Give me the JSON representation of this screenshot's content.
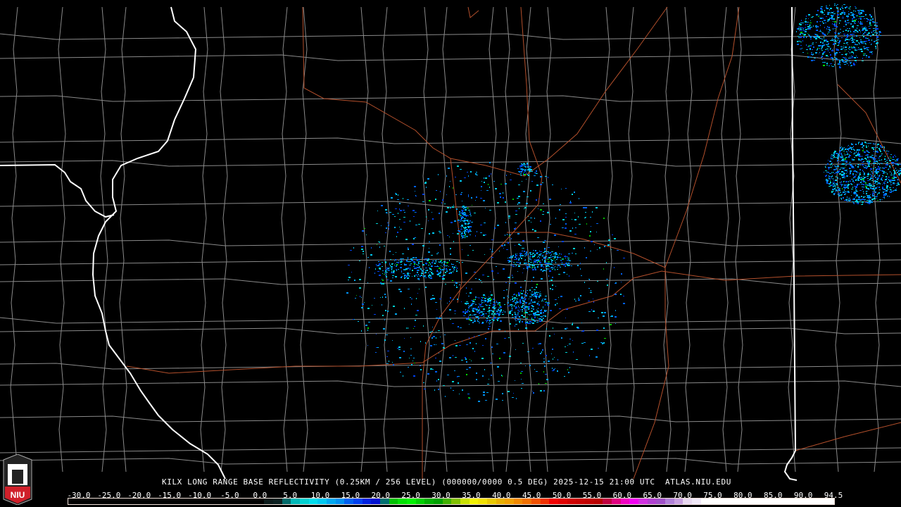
{
  "product": {
    "caption": "KILX LONG RANGE BASE REFLECTIVITY (0.25KM / 256 LEVEL) (000000/0000 0.5 DEG) 2025-12-15 21:00 UTC  ATLAS.NIU.EDU",
    "station": "KILX",
    "timestamp": "2025-12-15 21:00 UTC",
    "source": "ATLAS.NIU.EDU"
  },
  "logo": {
    "text": "NIU",
    "accent": "#d0202a"
  },
  "colorbar": {
    "ticks": [
      "-30.0",
      "-25.0",
      "-20.0",
      "-15.0",
      "-10.0",
      "-5.0",
      "0.0",
      "5.0",
      "10.0",
      "15.0",
      "20.0",
      "25.0",
      "30.0",
      "35.0",
      "40.0",
      "45.0",
      "50.0",
      "55.0",
      "60.0",
      "65.0",
      "70.0",
      "75.0",
      "80.0",
      "85.0",
      "90.0",
      "94.5"
    ],
    "colors": [
      "#000000",
      "#000000",
      "#000000",
      "#000000",
      "#000000",
      "#000000",
      "#000000",
      "#000000",
      "#000000",
      "#000000",
      "#000000",
      "#000000",
      "#000000",
      "#000000",
      "#000000",
      "#000000",
      "#000000",
      "#000000",
      "#000000",
      "#000000",
      "#000000",
      "#000000",
      "#0a1a1a",
      "#0a2020",
      "#006a6a",
      "#00b8b8",
      "#00d0d0",
      "#00dcec",
      "#00c8f0",
      "#00a8f0",
      "#0090f0",
      "#0060f0",
      "#0040f0",
      "#0020e0",
      "#0010d0",
      "#007070",
      "#00c000",
      "#00e000",
      "#00f000",
      "#00d000",
      "#00b000",
      "#00a000",
      "#40b000",
      "#80c000",
      "#c8e000",
      "#f0f000",
      "#f0e000",
      "#e8c800",
      "#e8b000",
      "#f0a000",
      "#f08800",
      "#f07000",
      "#f05000",
      "#f03000",
      "#f00000",
      "#e00000",
      "#d00000",
      "#c80000",
      "#c00000",
      "#b80000",
      "#c00040",
      "#e00080",
      "#f000c0",
      "#f000f0",
      "#d030e0",
      "#b040d0",
      "#a050c8",
      "#b080d8",
      "#c8a0e0",
      "#e8d8f0",
      "#f0e8f8",
      "#ffffff",
      "#ffffff",
      "#ffffff",
      "#ffffff",
      "#ffffff",
      "#ffffff",
      "#ffffff",
      "#ffffff",
      "#ffffff",
      "#ffffff",
      "#ffffff",
      "#ffffff",
      "#ffffff",
      "#ffffff",
      "#ffffff"
    ]
  },
  "colors": {
    "state_border": "#ffffff",
    "county_border": "#8a8a8a",
    "highway": "#b4502c"
  }
}
